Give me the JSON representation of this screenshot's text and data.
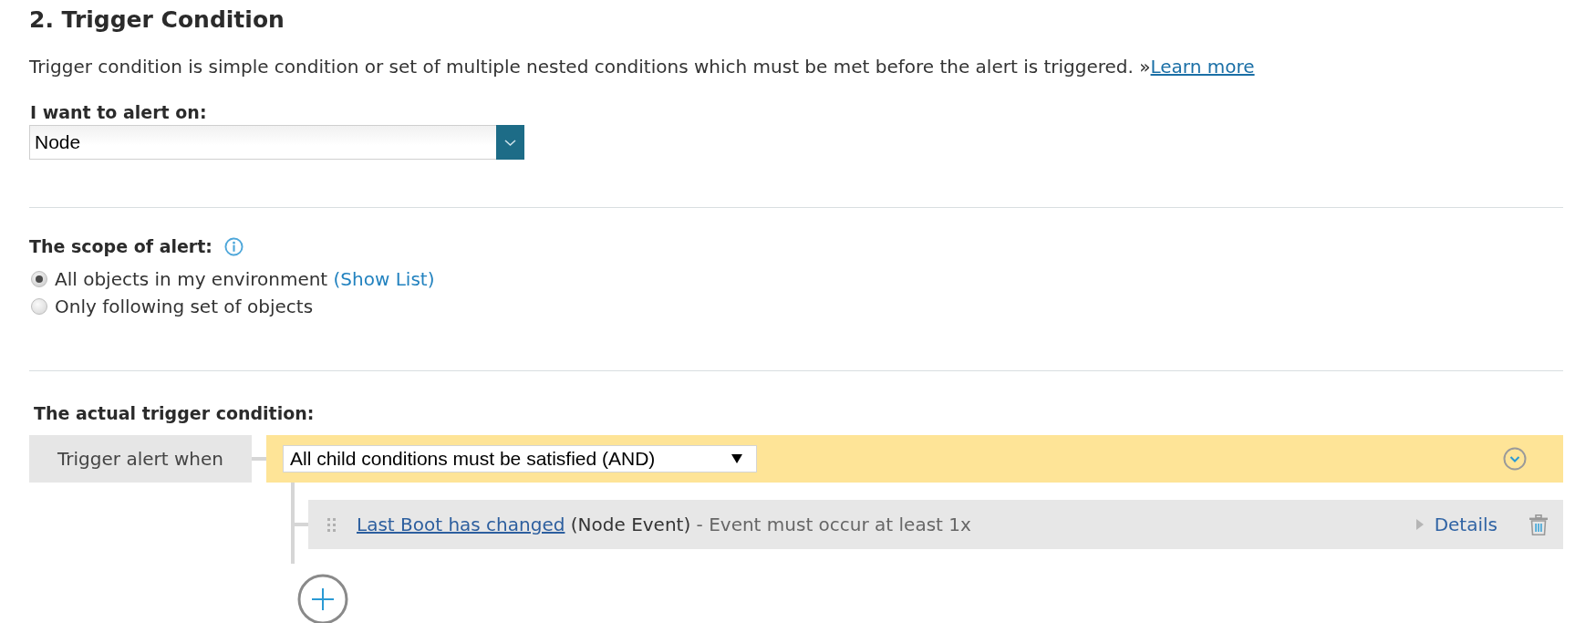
{
  "section": {
    "title": "2. Trigger Condition",
    "description": {
      "text": "Trigger condition is simple condition or set of multiple nested conditions which must be met before the alert is triggered. »",
      "link": "Learn more"
    }
  },
  "alert_on": {
    "label": "I want to alert on:",
    "value": "Node"
  },
  "scope": {
    "label": "The scope of alert:",
    "options": [
      {
        "label": "All objects in my environment",
        "link": "(Show List)",
        "selected": true
      },
      {
        "label": "Only following set of objects",
        "selected": false
      }
    ]
  },
  "trigger": {
    "label": "The actual trigger condition:",
    "when_label": "Trigger alert when",
    "operator": "All child conditions must be satisfied (AND)",
    "conditions": [
      {
        "name": "Last Boot has changed",
        "type": "(Node Event)",
        "detail": "- Event must occur at least 1x",
        "action": "Details"
      }
    ]
  }
}
